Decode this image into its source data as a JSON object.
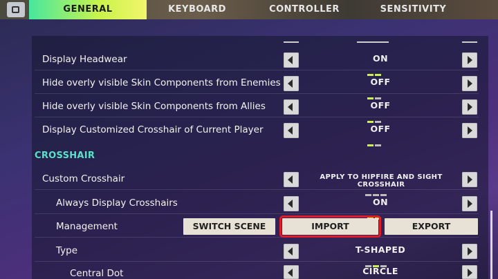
{
  "header": {
    "tabs": [
      {
        "label": "GENERAL",
        "active": true
      },
      {
        "label": "KEYBOARD",
        "active": false
      },
      {
        "label": "CONTROLLER",
        "active": false
      },
      {
        "label": "SENSITIVITY",
        "active": false
      }
    ],
    "q_key_icon": "key-hint-icon"
  },
  "settings": [
    {
      "label": "Display Headwear",
      "value": "ON"
    },
    {
      "label": "Hide overly visible Skin Components from Enemies",
      "value": "OFF"
    },
    {
      "label": "Hide overly visible Skin Components from Allies",
      "value": "OFF"
    },
    {
      "label": "Display Customized Crosshair of Current Player",
      "value": "OFF"
    }
  ],
  "crosshair": {
    "section_title": "CROSSHAIR",
    "custom_crosshair": {
      "label": "Custom Crosshair",
      "value": "APPLY TO HIPFIRE AND SIGHT CROSSHAIR"
    },
    "always_display": {
      "label": "Always Display Crosshairs",
      "value": "ON"
    },
    "management": {
      "label": "Management",
      "buttons": {
        "switch_scene": "SWITCH SCENE",
        "import": "IMPORT",
        "export": "EXPORT"
      },
      "highlight_color": "#e11b27"
    },
    "type": {
      "label": "Type",
      "value": "T-SHAPED"
    },
    "central_dot": {
      "label": "Central Dot",
      "value": "CIRCLE"
    }
  },
  "colors": {
    "active_tab_gradient": [
      "#47e7a0",
      "#c9f44b",
      "#f2f56b"
    ],
    "section_title": "#58e3c8",
    "indicator_active": "#cdef4f"
  }
}
